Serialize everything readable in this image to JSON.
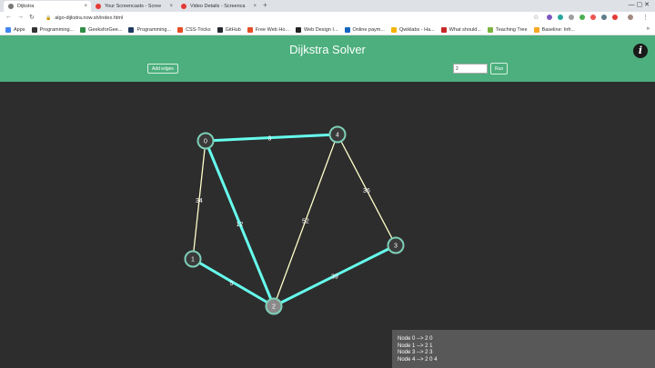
{
  "browser": {
    "tabs": [
      {
        "label": "Dijkstra",
        "active": true,
        "icon": "page-icon"
      },
      {
        "label": "Your Screencasts - Scree",
        "active": false,
        "icon": "youtube-icon"
      },
      {
        "label": "Video Details - Screenca",
        "active": false,
        "icon": "youtube-icon"
      }
    ],
    "new_tab": "+",
    "url": "algo-dijkstra.now.sh/index.html",
    "bookmarks": [
      {
        "label": "Apps",
        "color": "#4285f4"
      },
      {
        "label": "Programming...",
        "color": "#333333"
      },
      {
        "label": "GeeksforGee...",
        "color": "#2f8d46"
      },
      {
        "label": "Programming...",
        "color": "#1f3a5f"
      },
      {
        "label": "CSS-Tricks",
        "color": "#e44d26"
      },
      {
        "label": "GitHub",
        "color": "#24292e"
      },
      {
        "label": "Free Web Ho...",
        "color": "#e44d26"
      },
      {
        "label": "Web Design I...",
        "color": "#222222"
      },
      {
        "label": "Online paym...",
        "color": "#1565c0"
      },
      {
        "label": "Qwiklabs - Ha...",
        "color": "#f4b400"
      },
      {
        "label": "What should...",
        "color": "#c62828"
      },
      {
        "label": "Teaching Tree",
        "color": "#7cb342"
      },
      {
        "label": "Baseline: Infr...",
        "color": "#f9a825"
      }
    ],
    "more_bookmarks": "»"
  },
  "app": {
    "title": "Dijkstra Solver",
    "add_edges_label": "Add edges",
    "source_value": "2",
    "run_label": "Run",
    "info_glyph": "i"
  },
  "graph": {
    "colors": {
      "shortest": "#66ffee",
      "normal": "#ffffcc",
      "node_fill": "#8a8a8a",
      "node_stroke": "#7ecfb8",
      "label": "#ffffff"
    },
    "nodes": [
      {
        "id": "0",
        "label": "0"
      },
      {
        "id": "1",
        "label": "1"
      },
      {
        "id": "2",
        "label": "2"
      },
      {
        "id": "3",
        "label": "3"
      },
      {
        "id": "4",
        "label": "4"
      }
    ],
    "edges": [
      {
        "from": "0",
        "to": "4",
        "weight": "3",
        "in_shortest_path": true
      },
      {
        "from": "0",
        "to": "1",
        "weight": "34",
        "in_shortest_path": false
      },
      {
        "from": "0",
        "to": "2",
        "weight": "12",
        "in_shortest_path": true
      },
      {
        "from": "4",
        "to": "2",
        "weight": "52",
        "in_shortest_path": false
      },
      {
        "from": "4",
        "to": "3",
        "weight": "36",
        "in_shortest_path": false
      },
      {
        "from": "1",
        "to": "2",
        "weight": "5",
        "in_shortest_path": true
      },
      {
        "from": "2",
        "to": "3",
        "weight": "39",
        "in_shortest_path": true
      }
    ]
  },
  "results": [
    "Node 0 --> 2 0",
    "Node 1 --> 2 1",
    "Node 3 --> 2 3",
    "Node 4 --> 2 0 4"
  ]
}
